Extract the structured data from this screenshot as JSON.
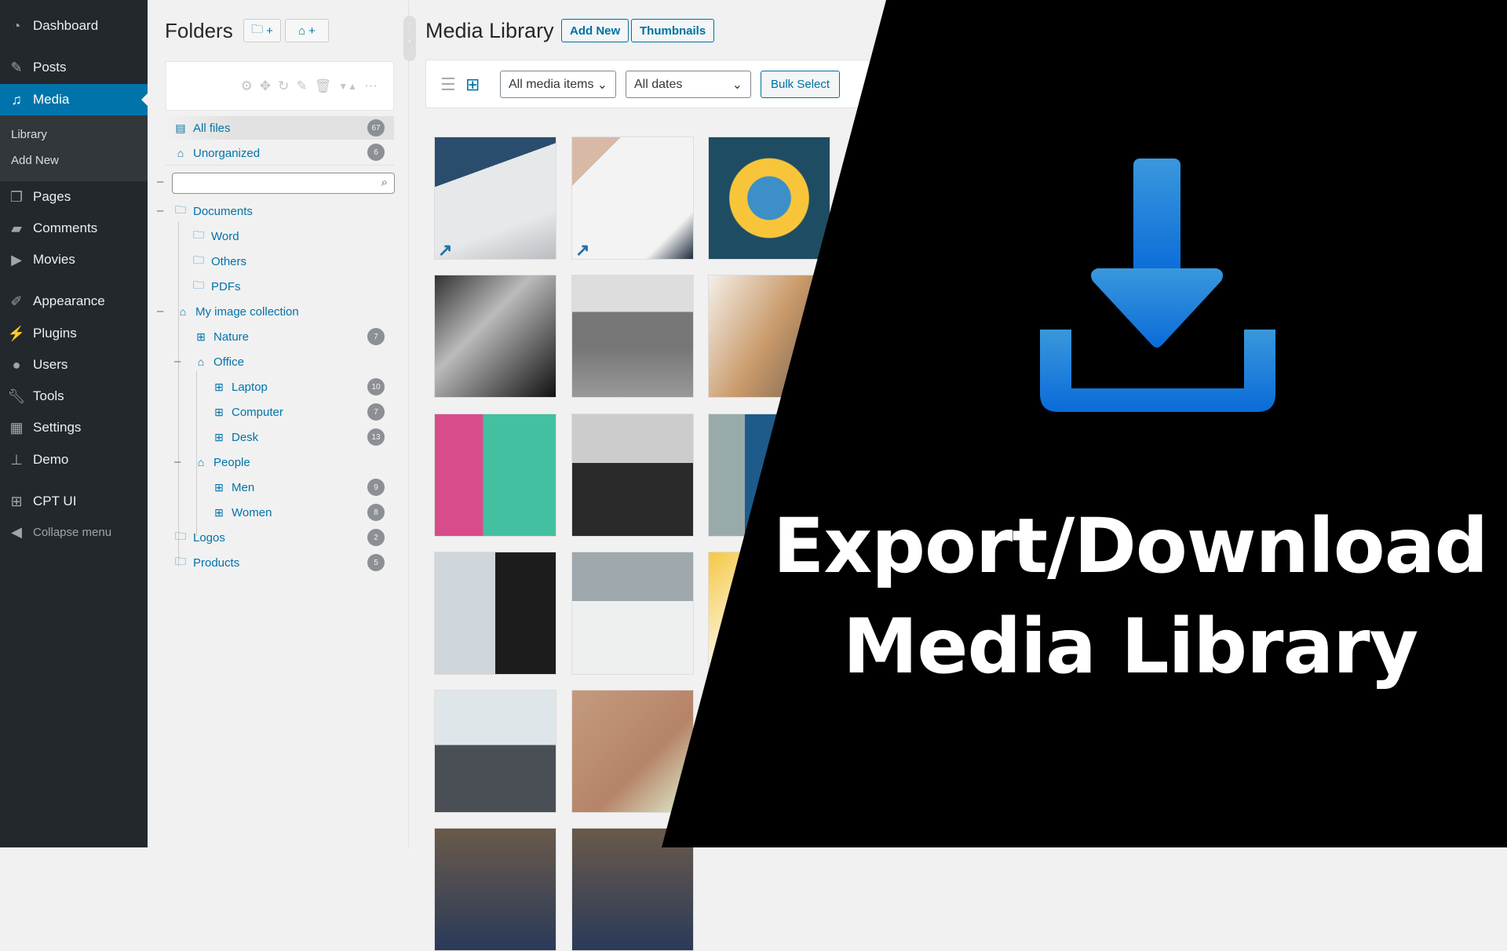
{
  "admin_menu": {
    "items": [
      {
        "label": "Dashboard",
        "icon": "dashboard-icon"
      },
      {
        "label": "Posts",
        "icon": "pin-icon"
      },
      {
        "label": "Media",
        "icon": "media-icon",
        "active": true
      },
      {
        "label": "Pages",
        "icon": "pages-icon"
      },
      {
        "label": "Comments",
        "icon": "comment-icon"
      },
      {
        "label": "Movies",
        "icon": "movie-icon"
      },
      {
        "label": "Appearance",
        "icon": "brush-icon"
      },
      {
        "label": "Plugins",
        "icon": "plug-icon"
      },
      {
        "label": "Users",
        "icon": "user-icon"
      },
      {
        "label": "Tools",
        "icon": "wrench-icon"
      },
      {
        "label": "Settings",
        "icon": "settings-icon"
      },
      {
        "label": "Demo",
        "icon": "sitemap-icon"
      },
      {
        "label": "CPT UI",
        "icon": "grid-icon"
      }
    ],
    "submenu": [
      "Library",
      "Add New"
    ],
    "collapse_label": "Collapse menu"
  },
  "folders": {
    "title": "Folders",
    "new_folder_button": "+",
    "new_gallery_button": "+",
    "all_files": {
      "label": "All files",
      "count": "67"
    },
    "unorganized": {
      "label": "Unorganized",
      "count": "6"
    },
    "search_placeholder": "",
    "tree": [
      {
        "label": "Documents",
        "type": "folder",
        "count": ""
      },
      {
        "label": "Word",
        "type": "folder",
        "count": ""
      },
      {
        "label": "Others",
        "type": "folder",
        "count": ""
      },
      {
        "label": "PDFs",
        "type": "folder",
        "count": ""
      },
      {
        "label": "My image collection",
        "type": "collection",
        "count": ""
      },
      {
        "label": "Nature",
        "type": "gallery",
        "count": "7"
      },
      {
        "label": "Office",
        "type": "collection",
        "count": ""
      },
      {
        "label": "Laptop",
        "type": "gallery",
        "count": "10"
      },
      {
        "label": "Computer",
        "type": "gallery",
        "count": "7"
      },
      {
        "label": "Desk",
        "type": "gallery",
        "count": "13"
      },
      {
        "label": "People",
        "type": "collection",
        "count": ""
      },
      {
        "label": "Men",
        "type": "gallery",
        "count": "9"
      },
      {
        "label": "Women",
        "type": "gallery",
        "count": "8"
      },
      {
        "label": "Logos",
        "type": "folder",
        "count": "2"
      },
      {
        "label": "Products",
        "type": "folder",
        "count": "5"
      }
    ]
  },
  "media_library": {
    "title": "Media Library",
    "add_new": "Add New",
    "thumbnails": "Thumbnails",
    "filter_type": "All media items",
    "filter_date": "All dates",
    "bulk_select": "Bulk Select",
    "tiles": [
      "monitor-desk",
      "office-desk",
      "owl-logo",
      "bw-elderly-women",
      "bw-rugby",
      "women-laughing",
      "women-mural",
      "bw-graduate",
      "man-blue-suit",
      "man-balcony",
      "desk-items",
      "sparkle",
      "window-plant",
      "wood-table",
      "",
      "",
      ""
    ]
  },
  "promo": {
    "line1": "Export/Download",
    "line2": "Media Library",
    "icon": "download-icon",
    "accent": "#1a73d8"
  }
}
